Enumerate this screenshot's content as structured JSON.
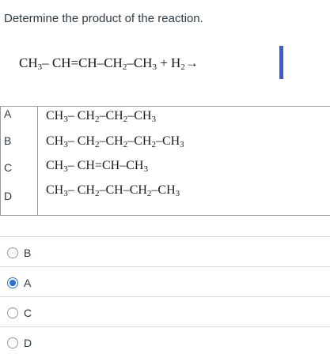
{
  "question": {
    "prompt": "Determine the product of the reaction."
  },
  "reaction": {
    "part1": "CH",
    "sub1": "3",
    "part2": "– CH=CH–CH",
    "sub2": "2",
    "part3": "–CH",
    "sub3": "3",
    "part4": " + H",
    "sub4": "2",
    "arrow": "→"
  },
  "options": [
    {
      "letter": "A",
      "segments": [
        "CH",
        "3",
        "– CH",
        "2",
        "–CH",
        "2",
        "–CH",
        "3"
      ]
    },
    {
      "letter": "B",
      "segments": [
        "CH",
        "3",
        "– CH",
        "2",
        "–CH",
        "2",
        "–CH",
        "2",
        "–CH",
        "3"
      ]
    },
    {
      "letter": "C",
      "segments": [
        "CH",
        "3",
        "– CH=CH–CH",
        "3"
      ]
    },
    {
      "letter": "D",
      "segments": [
        "CH",
        "3",
        "– CH",
        "2",
        "–CH–CH",
        "2",
        "–CH",
        "3"
      ]
    }
  ],
  "answers": [
    {
      "label": "B",
      "selected": false
    },
    {
      "label": "A",
      "selected": true
    },
    {
      "label": "C",
      "selected": false
    },
    {
      "label": "D",
      "selected": false
    }
  ],
  "colors": {
    "accent": "#3c5ecc",
    "radio_selected": "#2b6fd6",
    "text": "#2d3b45"
  }
}
